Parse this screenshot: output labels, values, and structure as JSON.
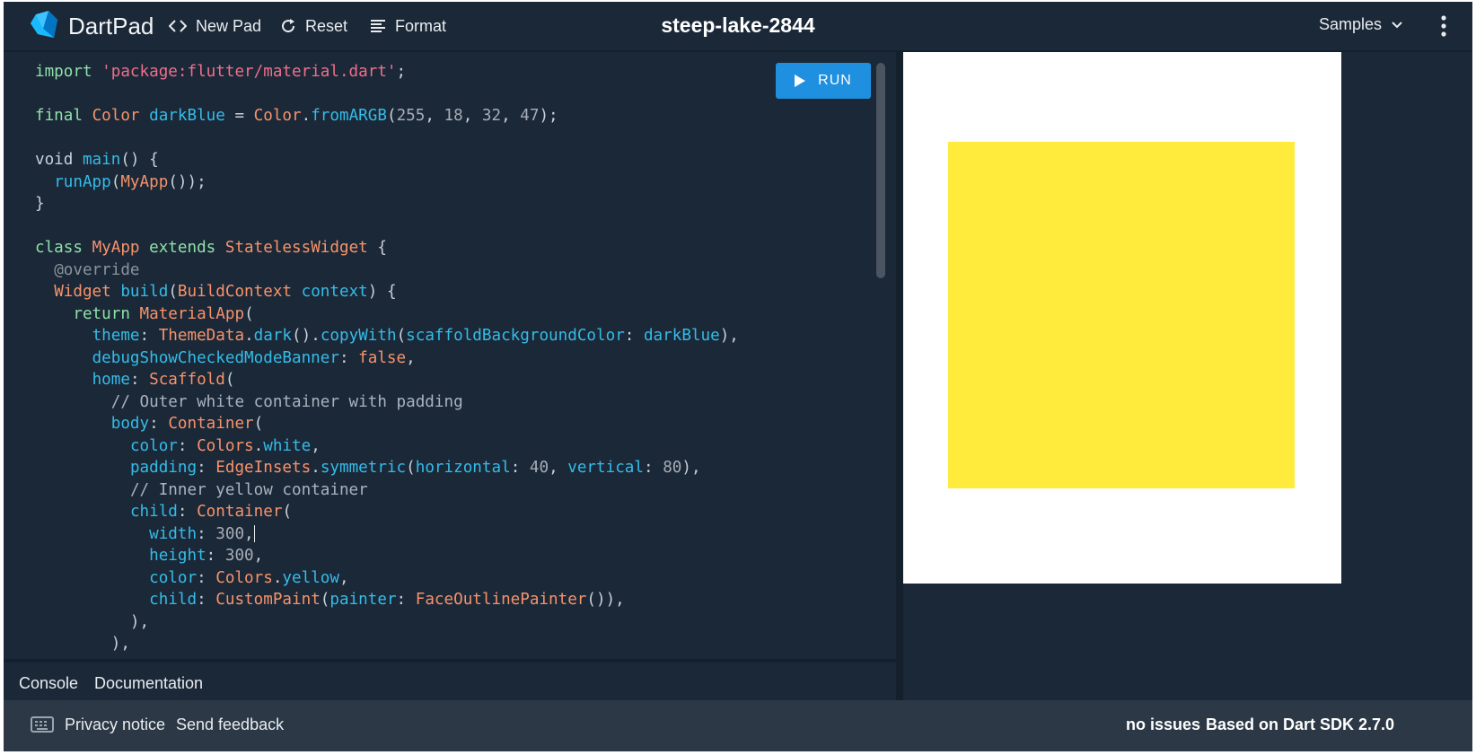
{
  "header": {
    "brand": "DartPad",
    "new_pad": "New Pad",
    "reset": "Reset",
    "format": "Format",
    "pad_title": "steep-lake-2844",
    "samples": "Samples"
  },
  "editor": {
    "run_label": "RUN",
    "lines": [
      [
        [
          "kw",
          "import "
        ],
        [
          "str",
          "'package:flutter/material.dart'"
        ],
        [
          "p",
          ";"
        ]
      ],
      [],
      [
        [
          "kw",
          "final "
        ],
        [
          "ty",
          "Color "
        ],
        [
          "fn",
          "darkBlue"
        ],
        [
          "p",
          " = "
        ],
        [
          "ty",
          "Color"
        ],
        [
          "p",
          "."
        ],
        [
          "fn",
          "fromARGB"
        ],
        [
          "p",
          "("
        ],
        [
          "num",
          "255"
        ],
        [
          "p",
          ", "
        ],
        [
          "num",
          "18"
        ],
        [
          "p",
          ", "
        ],
        [
          "num",
          "32"
        ],
        [
          "p",
          ", "
        ],
        [
          "num",
          "47"
        ],
        [
          "p",
          ");"
        ]
      ],
      [],
      [
        [
          "p",
          "void "
        ],
        [
          "fn",
          "main"
        ],
        [
          "p",
          "() {"
        ]
      ],
      [
        [
          "p",
          "  "
        ],
        [
          "fn",
          "runApp"
        ],
        [
          "p",
          "("
        ],
        [
          "ty",
          "MyApp"
        ],
        [
          "p",
          "());"
        ]
      ],
      [
        [
          "p",
          "}"
        ]
      ],
      [],
      [
        [
          "kw",
          "class "
        ],
        [
          "ty",
          "MyApp "
        ],
        [
          "kw",
          "extends "
        ],
        [
          "ty",
          "StatelessWidget"
        ],
        [
          "p",
          " {"
        ]
      ],
      [
        [
          "p",
          "  "
        ],
        [
          "an",
          "@override"
        ]
      ],
      [
        [
          "p",
          "  "
        ],
        [
          "ty",
          "Widget "
        ],
        [
          "fn",
          "build"
        ],
        [
          "p",
          "("
        ],
        [
          "ty",
          "BuildContext "
        ],
        [
          "fn",
          "context"
        ],
        [
          "p",
          ") {"
        ]
      ],
      [
        [
          "p",
          "    "
        ],
        [
          "kw",
          "return "
        ],
        [
          "ty",
          "MaterialApp"
        ],
        [
          "p",
          "("
        ]
      ],
      [
        [
          "p",
          "      "
        ],
        [
          "fn",
          "theme"
        ],
        [
          "p",
          ": "
        ],
        [
          "ty",
          "ThemeData"
        ],
        [
          "p",
          "."
        ],
        [
          "fn",
          "dark"
        ],
        [
          "p",
          "()."
        ],
        [
          "fn",
          "copyWith"
        ],
        [
          "p",
          "("
        ],
        [
          "fn",
          "scaffoldBackgroundColor"
        ],
        [
          "p",
          ": "
        ],
        [
          "fn",
          "darkBlue"
        ],
        [
          "p",
          "),"
        ]
      ],
      [
        [
          "p",
          "      "
        ],
        [
          "fn",
          "debugShowCheckedModeBanner"
        ],
        [
          "p",
          ": "
        ],
        [
          "ty",
          "false"
        ],
        [
          "p",
          ","
        ]
      ],
      [
        [
          "p",
          "      "
        ],
        [
          "fn",
          "home"
        ],
        [
          "p",
          ": "
        ],
        [
          "ty",
          "Scaffold"
        ],
        [
          "p",
          "("
        ]
      ],
      [
        [
          "p",
          "        "
        ],
        [
          "cm",
          "// Outer white container with padding"
        ]
      ],
      [
        [
          "p",
          "        "
        ],
        [
          "fn",
          "body"
        ],
        [
          "p",
          ": "
        ],
        [
          "ty",
          "Container"
        ],
        [
          "p",
          "("
        ]
      ],
      [
        [
          "p",
          "          "
        ],
        [
          "fn",
          "color"
        ],
        [
          "p",
          ": "
        ],
        [
          "ty",
          "Colors"
        ],
        [
          "p",
          "."
        ],
        [
          "fn",
          "white"
        ],
        [
          "p",
          ","
        ]
      ],
      [
        [
          "p",
          "          "
        ],
        [
          "fn",
          "padding"
        ],
        [
          "p",
          ": "
        ],
        [
          "ty",
          "EdgeInsets"
        ],
        [
          "p",
          "."
        ],
        [
          "fn",
          "symmetric"
        ],
        [
          "p",
          "("
        ],
        [
          "fn",
          "horizontal"
        ],
        [
          "p",
          ": "
        ],
        [
          "num",
          "40"
        ],
        [
          "p",
          ", "
        ],
        [
          "fn",
          "vertical"
        ],
        [
          "p",
          ": "
        ],
        [
          "num",
          "80"
        ],
        [
          "p",
          "),"
        ]
      ],
      [
        [
          "p",
          "          "
        ],
        [
          "cm",
          "// Inner yellow container"
        ]
      ],
      [
        [
          "p",
          "          "
        ],
        [
          "fn",
          "child"
        ],
        [
          "p",
          ": "
        ],
        [
          "ty",
          "Container"
        ],
        [
          "p",
          "("
        ]
      ],
      [
        [
          "p",
          "            "
        ],
        [
          "fn",
          "width"
        ],
        [
          "p",
          ": "
        ],
        [
          "num",
          "300"
        ],
        [
          "p",
          ","
        ],
        [
          "caret",
          ""
        ]
      ],
      [
        [
          "p",
          "            "
        ],
        [
          "fn",
          "height"
        ],
        [
          "p",
          ": "
        ],
        [
          "num",
          "300"
        ],
        [
          "p",
          ","
        ]
      ],
      [
        [
          "p",
          "            "
        ],
        [
          "fn",
          "color"
        ],
        [
          "p",
          ": "
        ],
        [
          "ty",
          "Colors"
        ],
        [
          "p",
          "."
        ],
        [
          "fn",
          "yellow"
        ],
        [
          "p",
          ","
        ]
      ],
      [
        [
          "p",
          "            "
        ],
        [
          "fn",
          "child"
        ],
        [
          "p",
          ": "
        ],
        [
          "ty",
          "CustomPaint"
        ],
        [
          "p",
          "("
        ],
        [
          "fn",
          "painter"
        ],
        [
          "p",
          ": "
        ],
        [
          "ty",
          "FaceOutlinePainter"
        ],
        [
          "p",
          "()),"
        ]
      ],
      [
        [
          "p",
          "          ),"
        ]
      ],
      [
        [
          "p",
          "        ),"
        ]
      ]
    ]
  },
  "output": {
    "outer_color": "#ffffff",
    "inner_color": "#ffeb3b"
  },
  "tabs": {
    "console": "Console",
    "documentation": "Documentation"
  },
  "footer": {
    "privacy": "Privacy notice",
    "feedback": "Send feedback",
    "issues": "no issues",
    "sdk": "Based on Dart SDK 2.7.0"
  },
  "icons": {
    "logo": "dart-logo-icon",
    "new_pad": "code-brackets-icon",
    "reset": "refresh-icon",
    "format": "format-lines-icon",
    "samples": "chevron-down-icon",
    "menu": "more-vertical-icon",
    "run": "play-icon",
    "keyboard": "keyboard-icon"
  }
}
